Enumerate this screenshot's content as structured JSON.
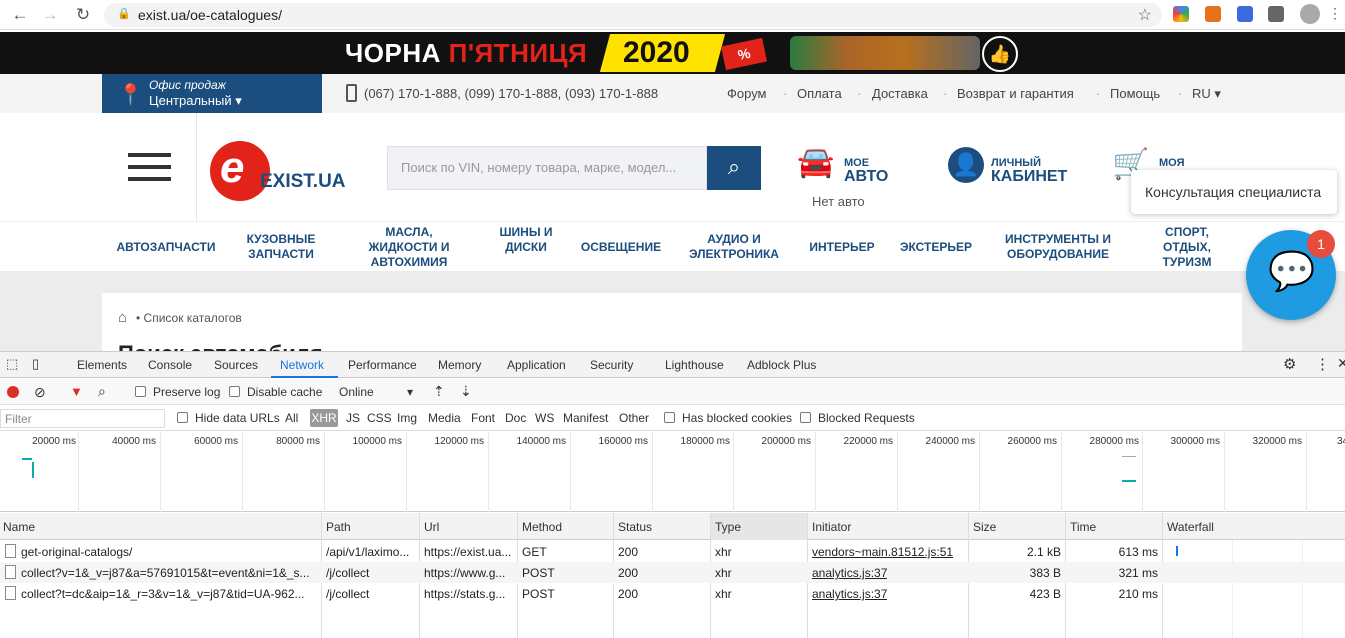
{
  "browser": {
    "url": "exist.ua/oe-catalogues/"
  },
  "banner": {
    "text_white": "ЧОРНА",
    "text_red": "П'ЯТНИЦЯ",
    "year": "2020",
    "percent": "%"
  },
  "topbar": {
    "office_label": "Офис продаж",
    "office_value": "Центральный",
    "phones": "(067) 170-1-888, (099) 170-1-888, (093) 170-1-888",
    "links": [
      "Форум",
      "Оплата",
      "Доставка",
      "Возврат и гарантия",
      "Помощь",
      "RU"
    ]
  },
  "header": {
    "logo_text": "EXIST.UA",
    "search_placeholder": "Поиск по VIN, номеру товара, марке, модел...",
    "my_auto_small": "МОЕ",
    "my_auto_big": "АВТО",
    "no_auto": "Нет авто",
    "cabinet_small": "ЛИЧНЫЙ",
    "cabinet_big": "КАБИНЕТ",
    "cart_small": "МОЯ"
  },
  "categories": [
    "АВТОЗАПЧАСТИ",
    "КУЗОВНЫЕ ЗАПЧАСТИ",
    "МАСЛА, ЖИДКОСТИ И АВТОХИМИЯ",
    "ШИНЫ И ДИСКИ",
    "ОСВЕЩЕНИЕ",
    "АУДИО И ЭЛЕКТРОНИКА",
    "ИНТЕРЬЕР",
    "ЭКСТЕРЬЕР",
    "ИНСТРУМЕНТЫ И ОБОРУДОВАНИЕ",
    "СПОРТ, ОТДЫХ, ТУРИЗМ"
  ],
  "breadcrumb": {
    "item": "Список каталогов",
    "page_title": "Поиск автомобиля"
  },
  "chat": {
    "tooltip": "Консультация специалиста",
    "badge": "1"
  },
  "devtools": {
    "tabs": [
      "Elements",
      "Console",
      "Sources",
      "Network",
      "Performance",
      "Memory",
      "Application",
      "Security",
      "Lighthouse",
      "Adblock Plus"
    ],
    "active_tab": "Network",
    "toolbar": {
      "preserve_log": "Preserve log",
      "disable_cache": "Disable cache",
      "throttle": "Online"
    },
    "filter": {
      "placeholder": "Filter",
      "hide_data_urls": "Hide data URLs",
      "types": [
        "All",
        "XHR",
        "JS",
        "CSS",
        "Img",
        "Media",
        "Font",
        "Doc",
        "WS",
        "Manifest",
        "Other"
      ],
      "active_type": "XHR",
      "has_blocked_cookies": "Has blocked cookies",
      "blocked_requests": "Blocked Requests"
    },
    "overview_ticks": [
      "20000 ms",
      "40000 ms",
      "60000 ms",
      "80000 ms",
      "100000 ms",
      "120000 ms",
      "140000 ms",
      "160000 ms",
      "180000 ms",
      "200000 ms",
      "220000 ms",
      "240000 ms",
      "260000 ms",
      "280000 ms",
      "300000 ms",
      "320000 ms",
      "34"
    ],
    "columns": [
      "Name",
      "Path",
      "Url",
      "Method",
      "Status",
      "Type",
      "Initiator",
      "Size",
      "Time",
      "Waterfall"
    ],
    "rows": [
      {
        "name": "get-original-catalogs/",
        "path": "/api/v1/laximo...",
        "url": "https://exist.ua...",
        "method": "GET",
        "status": "200",
        "type": "xhr",
        "initiator": "vendors~main.81512.js:51",
        "size": "2.1 kB",
        "time": "613 ms"
      },
      {
        "name": "collect?v=1&_v=j87&a=57691015&t=event&ni=1&_s...",
        "path": "/j/collect",
        "url": "https://www.g...",
        "method": "POST",
        "status": "200",
        "type": "xhr",
        "initiator": "analytics.js:37",
        "size": "383 B",
        "time": "321 ms"
      },
      {
        "name": "collect?t=dc&aip=1&_r=3&v=1&_v=j87&tid=UA-962...",
        "path": "/j/collect",
        "url": "https://stats.g...",
        "method": "POST",
        "status": "200",
        "type": "xhr",
        "initiator": "analytics.js:37",
        "size": "423 B",
        "time": "210 ms"
      }
    ]
  }
}
